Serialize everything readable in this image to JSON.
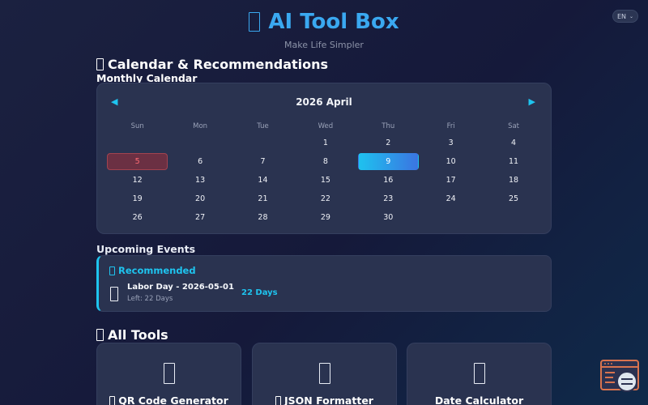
{
  "header": {
    "title": "AI Tool Box",
    "subtitle": "Make Life Simpler",
    "language": "EN",
    "title_color": "#3aa8f0"
  },
  "calendar_section": {
    "title": "Calendar & Recommendations",
    "subtitle": "Monthly Calendar"
  },
  "calendar": {
    "month_label": "2026 April",
    "prev_label": "◀",
    "next_label": "▶",
    "weekdays": [
      "Sun",
      "Mon",
      "Tue",
      "Wed",
      "Thu",
      "Fri",
      "Sat"
    ],
    "days": [
      "",
      "",
      "",
      "1",
      "2",
      "3",
      "4",
      "5",
      "6",
      "7",
      "8",
      "9",
      "10",
      "11",
      "12",
      "13",
      "14",
      "15",
      "16",
      "17",
      "18",
      "19",
      "20",
      "21",
      "22",
      "23",
      "24",
      "25",
      "26",
      "27",
      "28",
      "29",
      "30",
      "",
      ""
    ],
    "holiday_day": "5",
    "today_day": "9",
    "accent_color": "#1ec4ef",
    "holiday_color": "#ff6b74"
  },
  "events": {
    "title": "Upcoming Events",
    "recommended_label": "Recommended",
    "event_name": "Labor Day - 2026-05-01",
    "event_left": "Left: 22 Days",
    "event_days": "22 Days"
  },
  "tools": {
    "title": "All Tools",
    "items": [
      {
        "label": "QR Code Generator",
        "icon": "qr-code-icon"
      },
      {
        "label": "JSON Formatter",
        "icon": "code-braces-icon"
      },
      {
        "label": "Date Calculator",
        "icon": "calendar-icon"
      }
    ]
  }
}
